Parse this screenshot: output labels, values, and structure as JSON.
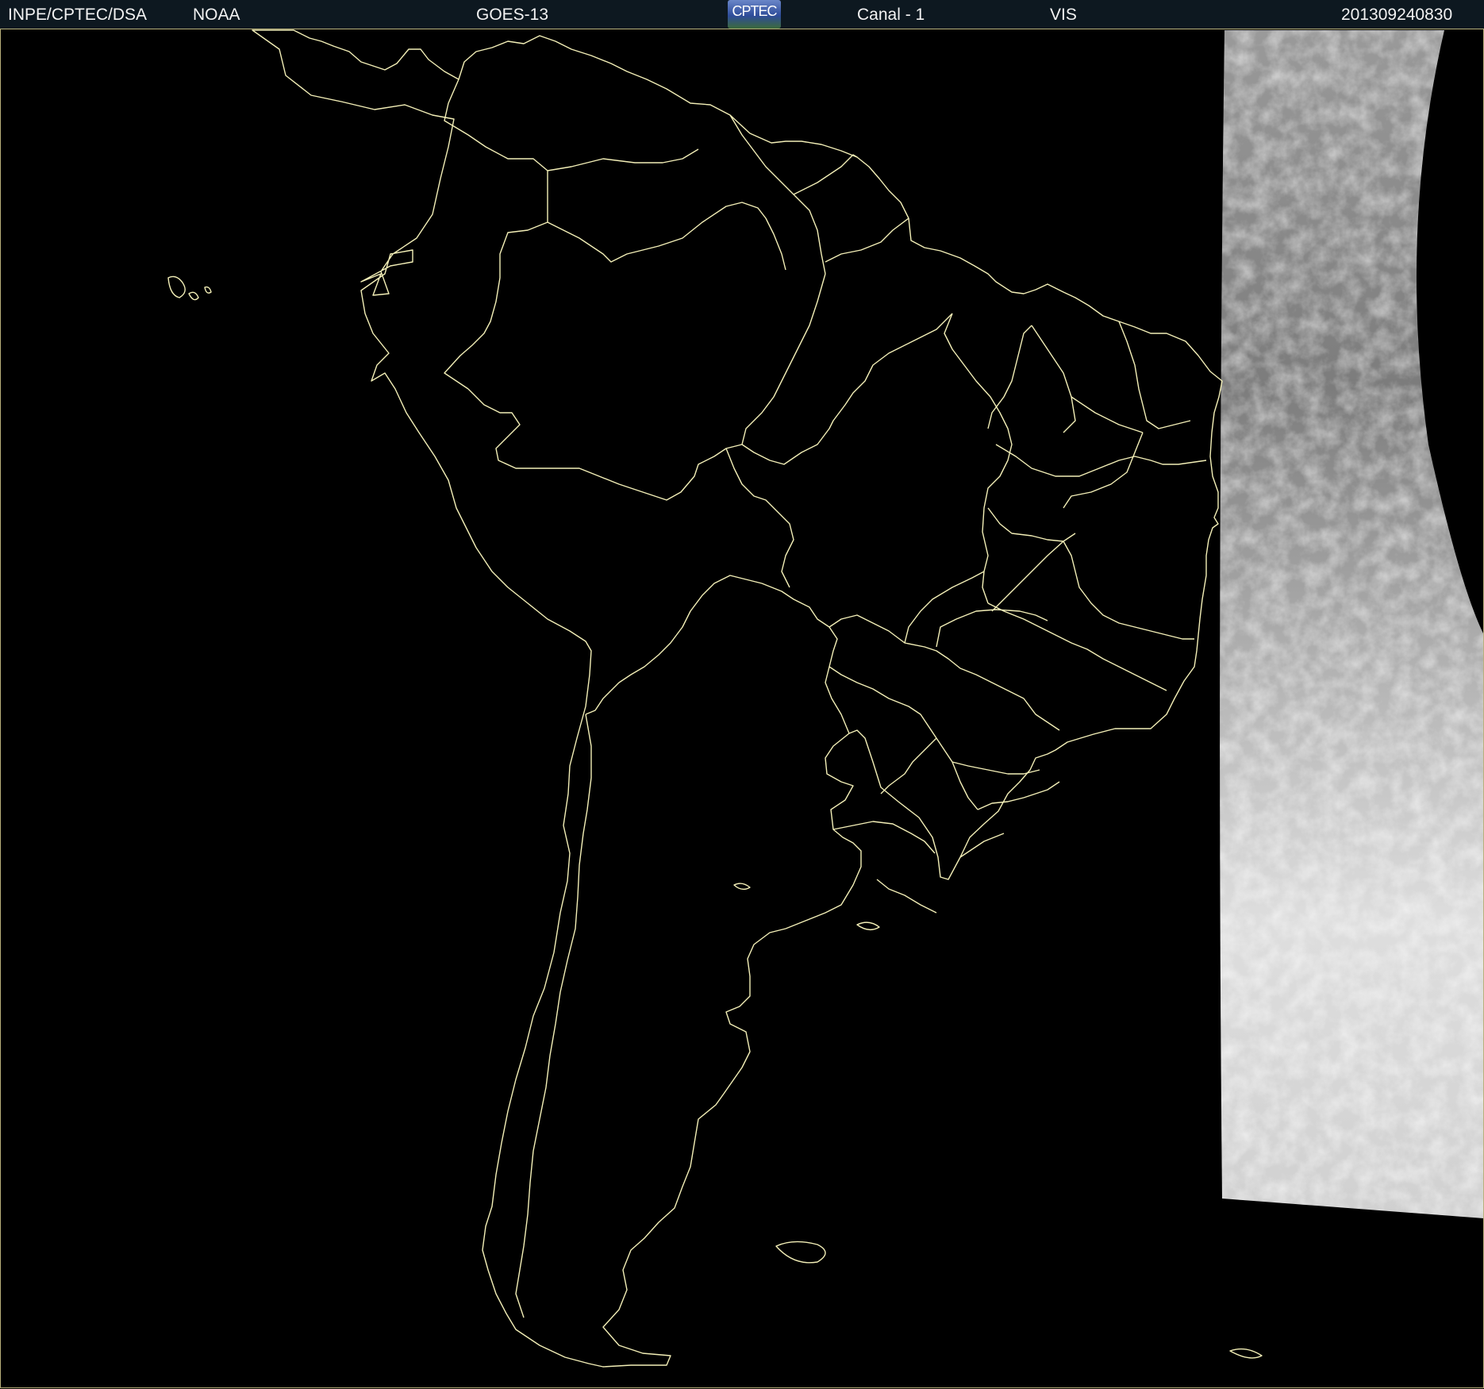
{
  "header": {
    "agency": "INPE/CPTEC/DSA",
    "provider": "NOAA",
    "satellite": "GOES-13",
    "logo_text": "CPTEC",
    "channel": "Canal - 1",
    "band": "VIS",
    "timestamp": "201309240830"
  },
  "colors": {
    "background": "#000000",
    "borders": "#f3efb7",
    "header_bg": "#0d1820"
  }
}
